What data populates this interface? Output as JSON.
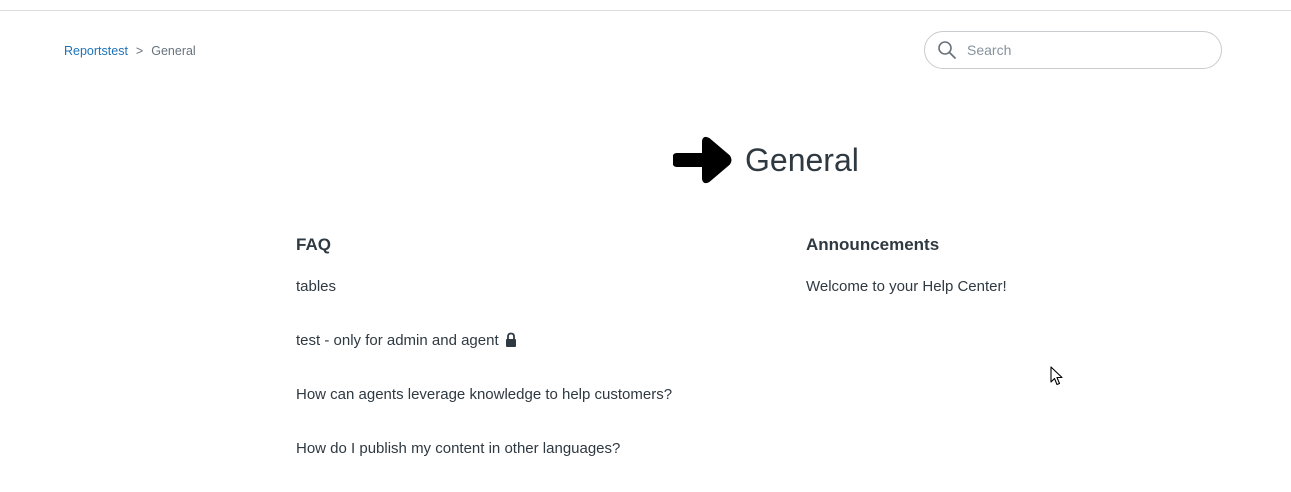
{
  "breadcrumbs": {
    "items": [
      {
        "label": "Reportstest"
      },
      {
        "label": "General"
      }
    ],
    "separator": ">"
  },
  "search": {
    "placeholder": "Search",
    "value": "",
    "icon": "search-icon"
  },
  "page": {
    "title": "General",
    "title_icon": "arrow-right-icon"
  },
  "sections": [
    {
      "title": "FAQ",
      "articles": [
        {
          "label": "tables",
          "locked": false
        },
        {
          "label": "test - only for admin and agent",
          "locked": true
        },
        {
          "label": "How can agents leverage knowledge to help customers?",
          "locked": false
        },
        {
          "label": "How do I publish my content in other languages?",
          "locked": false
        }
      ]
    },
    {
      "title": "Announcements",
      "articles": [
        {
          "label": "Welcome to your Help Center!",
          "locked": false
        }
      ]
    }
  ],
  "colors": {
    "link": "#1f73b7",
    "text": "#2f3941",
    "muted": "#68737d",
    "border": "#c8ccce"
  }
}
